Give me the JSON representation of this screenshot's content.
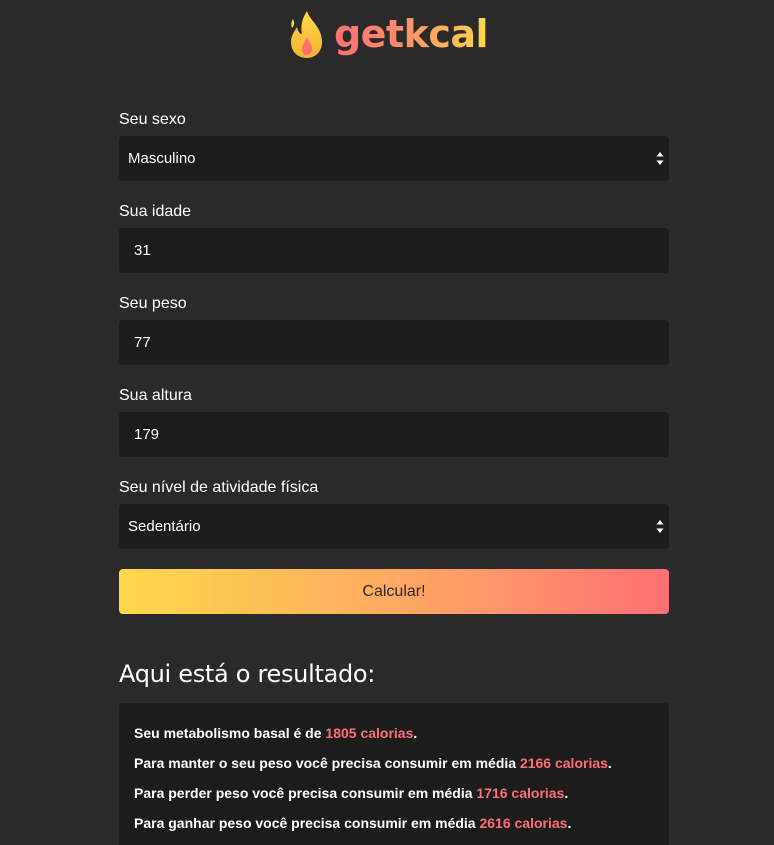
{
  "brand": {
    "logo_text": "getkcal",
    "logo_icon": "flame-icon",
    "accent_color": "#ff6f72",
    "gradient_start": "#fdd94a",
    "gradient_end": "#ff6f72"
  },
  "form": {
    "sex": {
      "label": "Seu sexo",
      "value": "Masculino"
    },
    "age": {
      "label": "Sua idade",
      "value": "31"
    },
    "weight": {
      "label": "Seu peso",
      "value": "77"
    },
    "height": {
      "label": "Sua altura",
      "value": "179"
    },
    "activity": {
      "label": "Seu nível de atividade física",
      "value": "Sedentário"
    },
    "submit_label": "Calcular!"
  },
  "result": {
    "title": "Aqui está o resultado:",
    "lines": [
      {
        "prefix": "Seu metabolismo basal é de ",
        "value": "1805 calorias",
        "suffix": "."
      },
      {
        "prefix": "Para manter o seu peso você precisa consumir em média ",
        "value": "2166 calorias",
        "suffix": "."
      },
      {
        "prefix": "Para perder peso você precisa consumir em média ",
        "value": "1716 calorias",
        "suffix": "."
      },
      {
        "prefix": "Para ganhar peso você precisa consumir em média ",
        "value": "2616 calorias",
        "suffix": "."
      }
    ]
  }
}
